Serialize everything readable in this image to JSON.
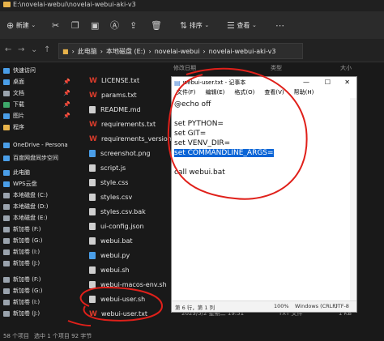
{
  "window": {
    "path": "E:\\novelai-webui\\novelai-webui-aki-v3"
  },
  "toolbar": {
    "new_label": "新建",
    "sort_label": "排序",
    "view_label": "查看"
  },
  "address": {
    "crumbs": [
      "此电脑",
      "本地磁盘 (E:)",
      "novelai-webui",
      "novelai-webui-aki-v3"
    ]
  },
  "columns": {
    "modified": "修改日期",
    "type": "类型",
    "size": "大小"
  },
  "sidebar": {
    "items": [
      {
        "label": "快速访问",
        "icon": "star-icon",
        "color": "#4a9ee8"
      },
      {
        "label": "桌面",
        "icon": "desktop-icon",
        "color": "#4a9ee8"
      },
      {
        "label": "文档",
        "icon": "document-icon",
        "color": "#9aa3ad"
      },
      {
        "label": "下载",
        "icon": "download-icon",
        "color": "#3ea86b"
      },
      {
        "label": "图片",
        "icon": "picture-icon",
        "color": "#4a9ee8"
      },
      {
        "label": "程序",
        "icon": "folder-icon",
        "color": "#e8b34b"
      },
      {
        "label": "OneDrive - Persona",
        "icon": "cloud-icon",
        "color": "#4a9ee8"
      },
      {
        "label": "百度网盘同步空间",
        "icon": "cloud-icon",
        "color": "#4a9ee8"
      },
      {
        "label": "此电脑",
        "icon": "computer-icon",
        "color": "#4a9ee8"
      },
      {
        "label": "WPS云盘",
        "icon": "cloud-icon",
        "color": "#4a9ee8"
      },
      {
        "label": "本地磁盘 (C:)",
        "icon": "drive-icon",
        "color": "#9aa3ad"
      },
      {
        "label": "本地磁盘 (D:)",
        "icon": "drive-icon",
        "color": "#9aa3ad"
      },
      {
        "label": "本地磁盘 (E:)",
        "icon": "drive-icon",
        "color": "#9aa3ad"
      },
      {
        "label": "新加卷 (F:)",
        "icon": "drive-icon",
        "color": "#9aa3ad"
      },
      {
        "label": "新加卷 (G:)",
        "icon": "drive-icon",
        "color": "#9aa3ad"
      },
      {
        "label": "新加卷 (I:)",
        "icon": "drive-icon",
        "color": "#9aa3ad"
      },
      {
        "label": "新加卷 (J:)",
        "icon": "drive-icon",
        "color": "#9aa3ad"
      },
      {
        "label": "新加卷 (F:)",
        "icon": "drive-icon",
        "color": "#9aa3ad"
      },
      {
        "label": "新加卷 (G:)",
        "icon": "drive-icon",
        "color": "#9aa3ad"
      },
      {
        "label": "新加卷 (I:)",
        "icon": "drive-icon",
        "color": "#9aa3ad"
      },
      {
        "label": "新加卷 (J:)",
        "icon": "drive-icon",
        "color": "#9aa3ad"
      }
    ]
  },
  "files": [
    {
      "name": "LICENSE.txt",
      "icon": "wps-text-icon",
      "color": "#d83b2b",
      "date": "",
      "type": "",
      "size": ""
    },
    {
      "name": "params.txt",
      "icon": "wps-text-icon",
      "color": "#d83b2b",
      "date": "",
      "type": "",
      "size": ""
    },
    {
      "name": "README.md",
      "icon": "file-icon",
      "color": "#cfcfcf",
      "date": "",
      "type": "",
      "size": ""
    },
    {
      "name": "requirements.txt",
      "icon": "wps-text-icon",
      "color": "#d83b2b",
      "date": "",
      "type": "",
      "size": ""
    },
    {
      "name": "requirements_versions.txt",
      "icon": "wps-text-icon",
      "color": "#d83b2b",
      "date": "",
      "type": "",
      "size": ""
    },
    {
      "name": "screenshot.png",
      "icon": "image-icon",
      "color": "#4a9ee8",
      "date": "",
      "type": "",
      "size": ""
    },
    {
      "name": "script.js",
      "icon": "file-icon",
      "color": "#cfcfcf",
      "date": "",
      "type": "",
      "size": ""
    },
    {
      "name": "style.css",
      "icon": "css-icon",
      "color": "#cfcfcf",
      "date": "",
      "type": "",
      "size": ""
    },
    {
      "name": "styles.csv",
      "icon": "csv-icon",
      "color": "#cfcfcf",
      "date": "",
      "type": "",
      "size": ""
    },
    {
      "name": "styles.csv.bak",
      "icon": "file-icon",
      "color": "#cfcfcf",
      "date": "",
      "type": "",
      "size": ""
    },
    {
      "name": "ui-config.json",
      "icon": "file-icon",
      "color": "#cfcfcf",
      "date": "",
      "type": "",
      "size": ""
    },
    {
      "name": "webui.bat",
      "icon": "bat-icon",
      "color": "#cfcfcf",
      "date": "",
      "type": "",
      "size": ""
    },
    {
      "name": "webui.py",
      "icon": "python-icon",
      "color": "#4a9ee8",
      "date": "",
      "type": "",
      "size": ""
    },
    {
      "name": "webui.sh",
      "icon": "file-icon",
      "color": "#cfcfcf",
      "date": "",
      "type": "",
      "size": ""
    },
    {
      "name": "webui-macos-env.sh",
      "icon": "file-icon",
      "color": "#cfcfcf",
      "date": "",
      "type": "",
      "size": ""
    },
    {
      "name": "webui-user.sh",
      "icon": "file-icon",
      "color": "#cfcfcf",
      "date": "2023/5/2",
      "type": "Shell Script",
      "size": ""
    },
    {
      "name": "webui-user.txt",
      "icon": "wps-text-icon",
      "color": "#d83b2b",
      "date": "2023/5/2 星期二 19:51",
      "type": "TXT 文件",
      "size": "1 KB"
    }
  ],
  "status": {
    "count": "58 个项目",
    "selected": "选中 1 个项目 92 字节"
  },
  "notepad": {
    "title": "webui-user.txt - 记事本",
    "menu": [
      "文件(F)",
      "编辑(E)",
      "格式(O)",
      "查看(V)",
      "帮助(H)"
    ],
    "lines": [
      "@echo off",
      "",
      "set PYTHON=",
      "set GIT=",
      "set VENV_DIR=",
      "set COMMANDLINE_ARGS=",
      "",
      "call webui.bat"
    ],
    "highlight_line_index": 5,
    "status": {
      "pos": "第 6 行，第 1 列",
      "zoom": "100%",
      "eol": "Windows (CRLF)",
      "enc": "UTF-8"
    }
  },
  "colors": {
    "accent": "#0a64d6",
    "annotation": "#e0201a"
  }
}
